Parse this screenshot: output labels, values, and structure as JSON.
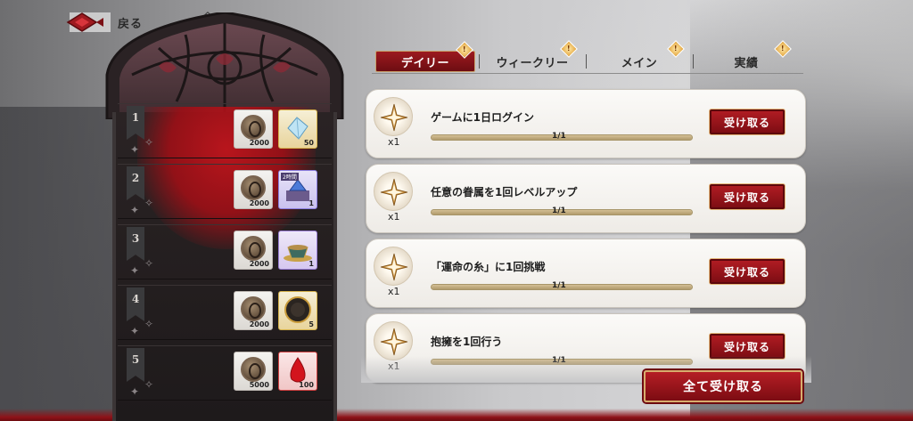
{
  "header": {
    "back_label": "戻る"
  },
  "colors": {
    "accent": "#9c1a1f",
    "gold": "#d8ad6d",
    "panel": "#231e1f"
  },
  "rewards_panel": {
    "rows": [
      {
        "rank": "1",
        "items": [
          {
            "icon": "coin-icon",
            "qty": "2000"
          },
          {
            "icon": "crystal-icon",
            "qty": "50"
          }
        ]
      },
      {
        "rank": "2",
        "items": [
          {
            "icon": "coin-icon",
            "qty": "2000"
          },
          {
            "icon": "gem-chest-icon",
            "qty": "1",
            "tag": "2時間"
          }
        ]
      },
      {
        "rank": "3",
        "items": [
          {
            "icon": "coin-icon",
            "qty": "2000"
          },
          {
            "icon": "teacup-icon",
            "qty": "1"
          }
        ]
      },
      {
        "rank": "4",
        "items": [
          {
            "icon": "coin-icon",
            "qty": "2000"
          },
          {
            "icon": "mirror-icon",
            "qty": "5"
          }
        ]
      },
      {
        "rank": "5",
        "items": [
          {
            "icon": "coin-icon",
            "qty": "5000"
          },
          {
            "icon": "blood-drop-icon",
            "qty": "100"
          }
        ]
      }
    ]
  },
  "tabs": [
    {
      "label": "デイリー",
      "active": true,
      "badge": "!"
    },
    {
      "label": "ウィークリー",
      "active": false,
      "badge": "!"
    },
    {
      "label": "メイン",
      "active": false,
      "badge": "!"
    },
    {
      "label": "実績",
      "active": false,
      "badge": "!"
    }
  ],
  "missions": [
    {
      "title": "ゲームに1日ログイン",
      "multiplier": "x1",
      "progress": "1/1",
      "progress_fraction": 1.0,
      "claim_label": "受け取る"
    },
    {
      "title": "任意の眷属を1回レベルアップ",
      "multiplier": "x1",
      "progress": "1/1",
      "progress_fraction": 1.0,
      "claim_label": "受け取る"
    },
    {
      "title": "「運命の糸」に1回挑戦",
      "multiplier": "x1",
      "progress": "1/1",
      "progress_fraction": 1.0,
      "claim_label": "受け取る"
    },
    {
      "title": "抱擁を1回行う",
      "multiplier": "x1",
      "progress": "1/1",
      "progress_fraction": 1.0,
      "claim_label": "受け取る"
    }
  ],
  "claim_all_label": "全て受け取る"
}
